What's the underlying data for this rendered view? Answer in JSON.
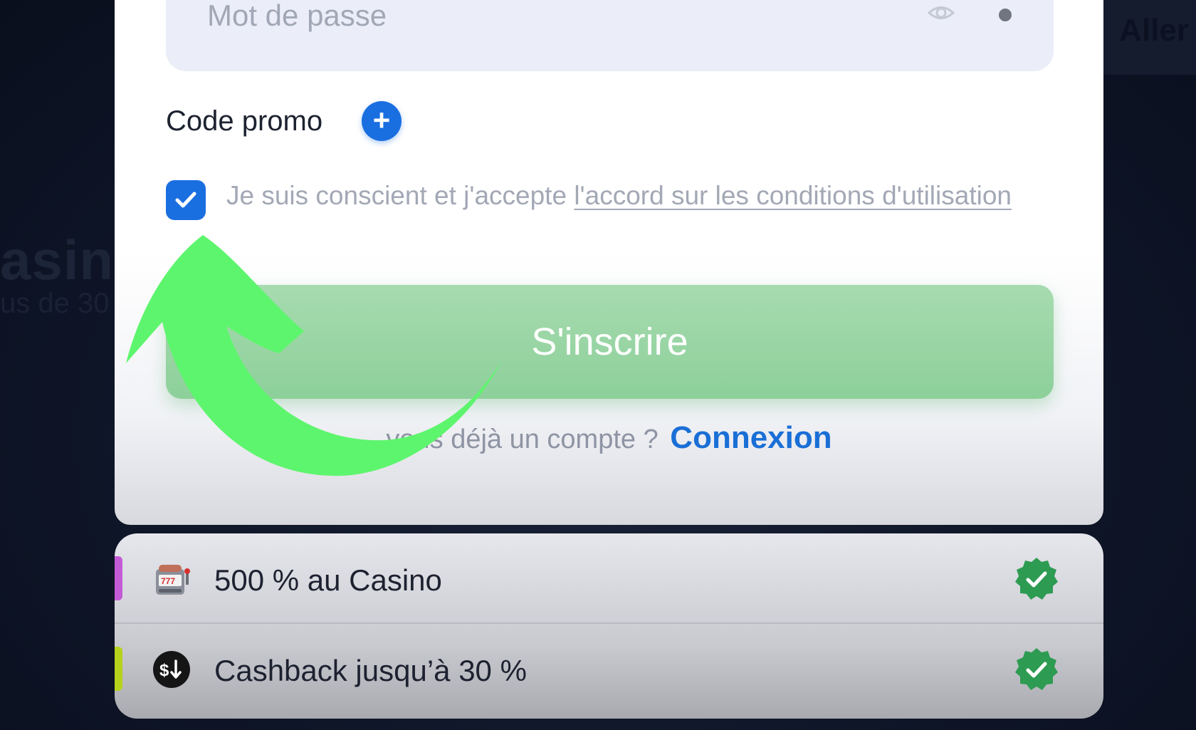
{
  "background": {
    "top_right_button": "Aller",
    "heading_fragment": "asin",
    "subheading_fragment": "us de 30"
  },
  "form": {
    "password_placeholder": "Mot de passe",
    "promo_label": "Code promo",
    "promo_add_symbol": "+",
    "terms_checked": true,
    "terms_text": "Je suis conscient et j'accepte ",
    "terms_link": "l'accord sur les conditions d'utilisation",
    "signup_label": "S'inscrire",
    "login_prompt": "vous déjà un compte ?",
    "login_link": "Connexion"
  },
  "bonuses": [
    {
      "label": "500 % au Casino",
      "icon": "slot-machine-icon",
      "accent": "#c45bd6",
      "status": "verified"
    },
    {
      "label": "Cashback jusqu’à 30 %",
      "icon": "cashback-icon",
      "accent": "#b6d21c",
      "status": "verified"
    }
  ],
  "colors": {
    "primary": "#1a6fe0",
    "signup_green": "#8dd09a",
    "verified_green": "#2e9b52",
    "arrow_green": "#5ef56e"
  }
}
